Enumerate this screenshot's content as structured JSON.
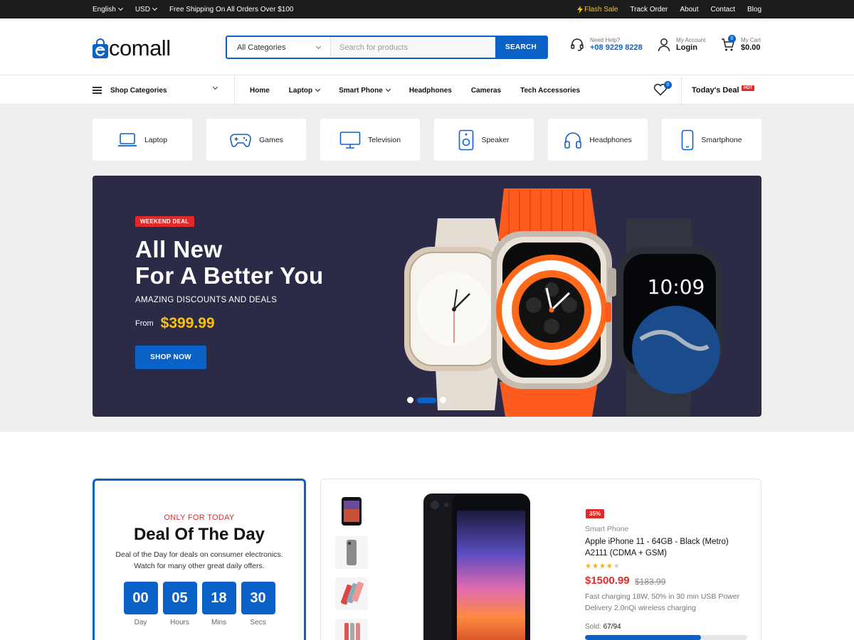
{
  "topbar": {
    "language": "English",
    "currency": "USD",
    "shipping": "Free Shipping On All Orders Over $100",
    "links": [
      "Flash Sale",
      "Track Order",
      "About",
      "Contact",
      "Blog"
    ]
  },
  "header": {
    "logo_text": "comall",
    "search": {
      "category": "All Categories",
      "placeholder": "Search for products",
      "button": "SEARCH"
    },
    "help": {
      "label": "Need Help?",
      "phone": "+08 9229 8228"
    },
    "account": {
      "label": "My Account",
      "action": "Login"
    },
    "cart": {
      "label": "My Cart",
      "total": "$0.00",
      "count": "0"
    }
  },
  "nav": {
    "shop_categories": "Shop Categories",
    "links": [
      "Home",
      "Laptop",
      "Smart Phone",
      "Headphones",
      "Cameras",
      "Tech Accessories"
    ],
    "wishlist_count": "0",
    "todays_deal": "Today's Deal",
    "hot": "HOT"
  },
  "categories": [
    "Laptop",
    "Games",
    "Television",
    "Speaker",
    "Headphones",
    "Smartphone"
  ],
  "hero": {
    "tag": "WEEKEND DEAL",
    "title_line1": "All New",
    "title_line2": "For A Better You",
    "subtitle": "AMAZING DISCOUNTS AND DEALS",
    "from_label": "From",
    "price": "$399.99",
    "button": "SHOP NOW",
    "watch_time": "10:09",
    "slides": 3,
    "active_slide": 2
  },
  "deal_of_day": {
    "eyebrow": "ONLY FOR TODAY",
    "title": "Deal Of The Day",
    "description": "Deal of the Day for deals on consumer electronics. Watch for many other great daily offers.",
    "timer": [
      {
        "value": "00",
        "label": "Day"
      },
      {
        "value": "05",
        "label": "Hours"
      },
      {
        "value": "18",
        "label": "Mins"
      },
      {
        "value": "30",
        "label": "Secs"
      }
    ]
  },
  "product": {
    "discount": "35%",
    "category": "Smart Phone",
    "title": "Apple iPhone 11 - 64GB - Black (Metro) A2111 (CDMA + GSM)",
    "rating": 4,
    "rating_max": 5,
    "price": "$1500.99",
    "old_price": "$183.99",
    "description": "Fast charging 18W, 50% in 30 min USB Power Delivery 2.0nQi wireless charging",
    "sold_label": "Sold:",
    "sold_value": "67/94",
    "sold_fraction": 0.713
  },
  "colors": {
    "brand": "#0a62c9",
    "accent": "#e12b2b",
    "price": "#ffc107",
    "hero_bg": "#2b2a47"
  }
}
